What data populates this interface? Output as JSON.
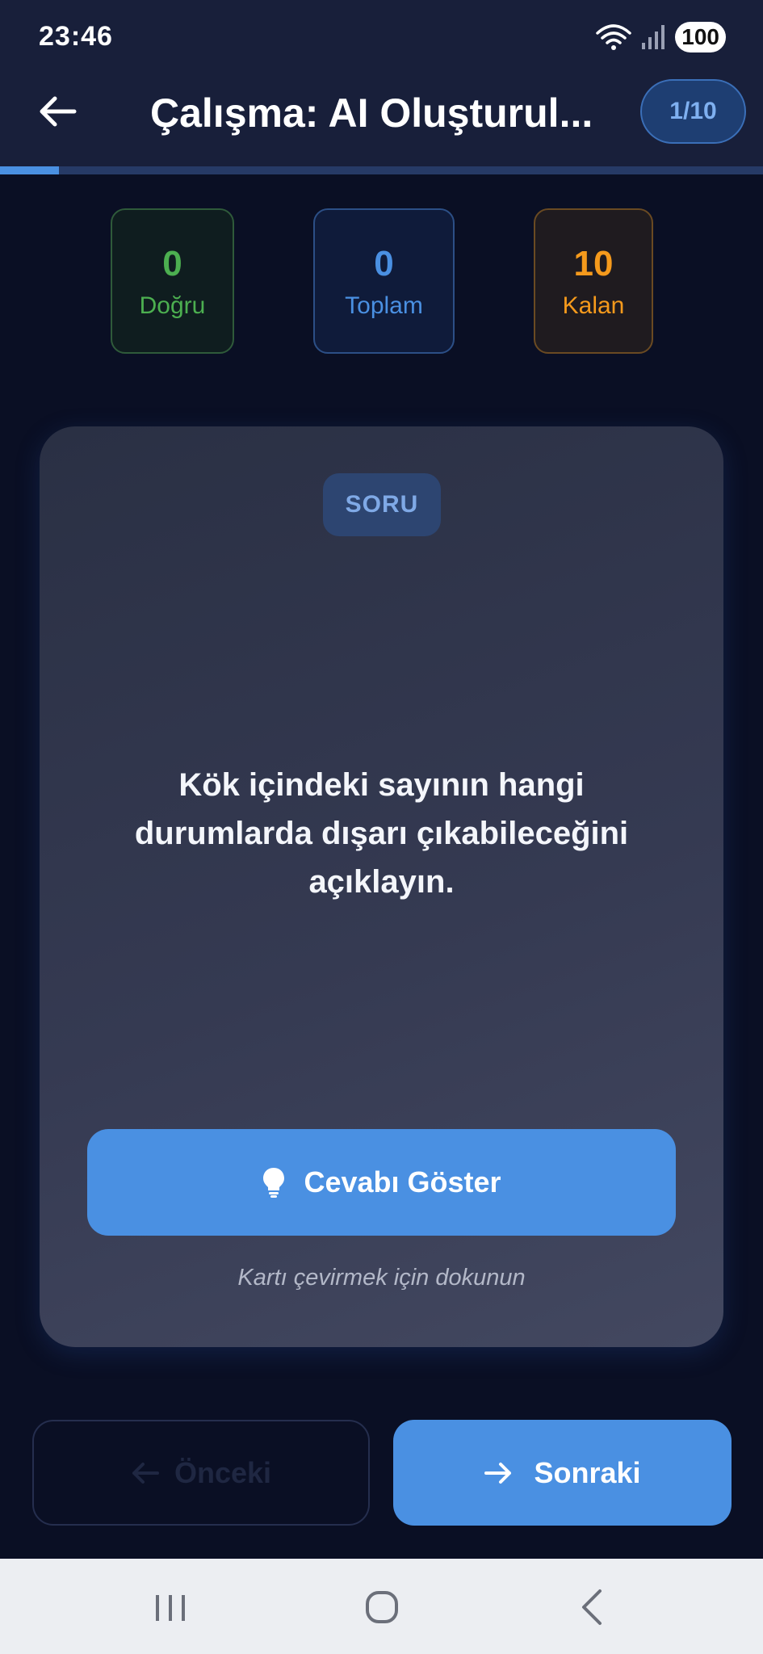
{
  "status_bar": {
    "time": "23:46",
    "battery": "100",
    "icons": [
      "wifi-icon",
      "signal-icon",
      "battery-icon"
    ]
  },
  "header": {
    "back_icon": "arrow-left-icon",
    "title": "Çalışma: AI Oluşturul...",
    "counter": "1/10"
  },
  "progress": {
    "current": 1,
    "total": 10,
    "fraction": 0.1
  },
  "stats": {
    "correct": {
      "value": "0",
      "label": "Doğru"
    },
    "total": {
      "value": "0",
      "label": "Toplam"
    },
    "remaining": {
      "value": "10",
      "label": "Kalan"
    }
  },
  "card": {
    "badge": "SORU",
    "question": "Kök içindeki sayının hangi durumlarda dışarı çıkabileceğini açıklayın.",
    "reveal_button": {
      "icon": "lightbulb-icon",
      "label": "Cevabı Göster"
    },
    "hint": "Kartı çevirmek için dokunun"
  },
  "nav_buttons": {
    "previous": {
      "icon": "arrow-left-icon",
      "label": "Önceki",
      "enabled": false
    },
    "next": {
      "icon": "arrow-right-icon",
      "label": "Sonraki",
      "enabled": true
    }
  },
  "system_nav": {
    "icons": [
      "recents-icon",
      "home-icon",
      "back-icon"
    ]
  },
  "colors": {
    "background": "#0a0f24",
    "header": "#181f3a",
    "accent": "#4a90e2",
    "correct": "#4caf50",
    "remaining": "#f59a1c"
  }
}
